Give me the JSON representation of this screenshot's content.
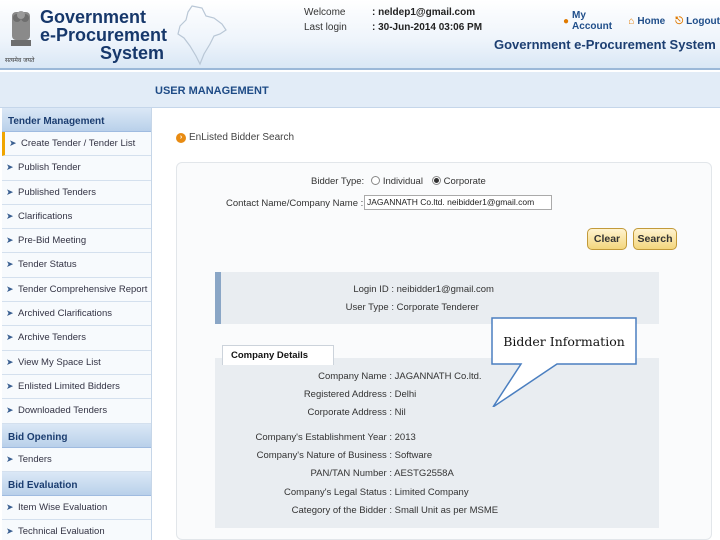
{
  "header": {
    "logo_line1": "Government",
    "logo_line2": "e-Procurement",
    "logo_line3": "System",
    "emblem_caption": "सत्यमेव जयते",
    "welcome_label": "Welcome",
    "welcome_value": ":  neldep1@gmail.com",
    "lastlogin_label": "Last login",
    "lastlogin_value": ":  30-Jun-2014 03:06 PM",
    "links": {
      "my_account": "My Account",
      "home": "Home",
      "logout": "Logout"
    },
    "system_title": "Government e-Procurement System"
  },
  "band": {
    "heading": "USER MANAGEMENT"
  },
  "sidebar": {
    "sections": [
      {
        "title": "Tender Management",
        "items": [
          "Create Tender / Tender List",
          "Publish Tender",
          "Published Tenders",
          "Clarifications",
          "Pre-Bid Meeting",
          "Tender Status",
          "Tender Comprehensive Report",
          "Archived Clarifications",
          "Archive Tenders",
          "View My Space List",
          "Enlisted Limited Bidders",
          "Downloaded Tenders"
        ]
      },
      {
        "title": "Bid Opening",
        "items": [
          "Tenders"
        ]
      },
      {
        "title": "Bid Evaluation",
        "items": [
          "Item Wise Evaluation",
          "Technical Evaluation"
        ]
      }
    ]
  },
  "breadcrumb": "EnListed Bidder Search",
  "search_form": {
    "bidder_type_label": "Bidder Type:",
    "option_individual": "Individual",
    "option_corporate": "Corporate",
    "selected": "Corporate",
    "contact_label": "Contact Name/Company Name :",
    "required_mark": "*",
    "contact_value": "JAGANNATH Co.ltd. neibidder1@gmail.com",
    "clear_label": "Clear",
    "search_label": "Search"
  },
  "login_info": {
    "login_id_label": "Login ID :",
    "login_id_value": "neibidder1@gmail.com",
    "user_type_label": "User Type :",
    "user_type_value": "Corporate Tenderer"
  },
  "company": {
    "title": "Company Details",
    "fields": [
      {
        "label": "Company Name :",
        "value": "JAGANNATH Co.ltd."
      },
      {
        "label": "Registered Address :",
        "value": "Delhi"
      },
      {
        "label": "Corporate Address :",
        "value": "Nil"
      },
      {
        "label": "Company's Establishment Year :",
        "value": "2013"
      },
      {
        "label": "Company's Nature of Business :",
        "value": "Software"
      },
      {
        "label": "PAN/TAN Number :",
        "value": "AESTG2558A"
      },
      {
        "label": "Company's Legal Status :",
        "value": "Limited Company"
      },
      {
        "label": "Category of the Bidder :",
        "value": "Small Unit as per MSME"
      }
    ]
  },
  "callout": {
    "text": "Bidder Information"
  }
}
